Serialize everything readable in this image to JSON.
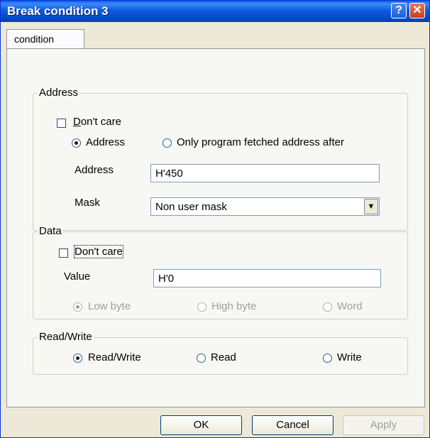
{
  "window": {
    "title": "Break condition 3"
  },
  "tabs": [
    "condition"
  ],
  "address_group": {
    "label": "Address",
    "dont_care": "Don't care",
    "radio_address": "Address",
    "radio_only_program": "Only program fetched address after",
    "address_label": "Address",
    "address_value": "H'450",
    "mask_label": "Mask",
    "mask_value": "Non user mask"
  },
  "data_group": {
    "label": "Data",
    "dont_care": "Don't care",
    "value_label": "Value",
    "value": "H'0",
    "low_byte": "Low byte",
    "high_byte": "High byte",
    "word": "Word"
  },
  "rw_group": {
    "label": "Read/Write",
    "read_write": "Read/Write",
    "read": "Read",
    "write": "Write"
  },
  "buttons": {
    "ok": "OK",
    "cancel": "Cancel",
    "apply": "Apply"
  },
  "icons": {
    "help": "question-mark",
    "close": "x"
  }
}
